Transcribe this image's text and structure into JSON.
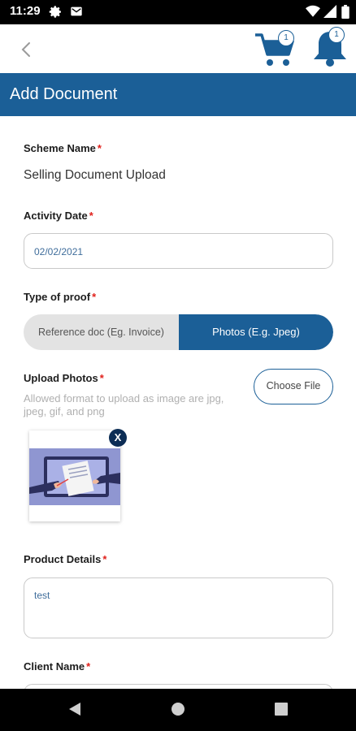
{
  "status_bar": {
    "time": "11:29",
    "icons": [
      "gear-icon",
      "gmail-icon",
      "wifi-icon",
      "signal-icon",
      "battery-icon"
    ]
  },
  "header": {
    "cart_count": "1",
    "notification_count": "1"
  },
  "page": {
    "title": "Add Document"
  },
  "form": {
    "scheme_name": {
      "label": "Scheme Name",
      "required_mark": "*",
      "value": "Selling Document Upload"
    },
    "activity_date": {
      "label": "Activity Date",
      "required_mark": "*",
      "value": "02/02/2021"
    },
    "type_of_proof": {
      "label": "Type of proof",
      "required_mark": "*",
      "options": [
        "Reference doc (Eg. Invoice)",
        "Photos (E.g. Jpeg)"
      ],
      "selected": "Photos (E.g. Jpeg)"
    },
    "upload_photos": {
      "label": "Upload Photos",
      "required_mark": "*",
      "hint": "Allowed format to upload as image are jpg, jpeg, gif, and png",
      "choose_file_label": "Choose File",
      "remove_label": "X"
    },
    "product_details": {
      "label": "Product Details",
      "required_mark": "*",
      "value": "test"
    },
    "client_name": {
      "label": "Client Name",
      "required_mark": "*",
      "value": ""
    }
  },
  "colors": {
    "brand_blue": "#1b5f97",
    "required_red": "#e0201b",
    "status_bar": "#000000"
  }
}
